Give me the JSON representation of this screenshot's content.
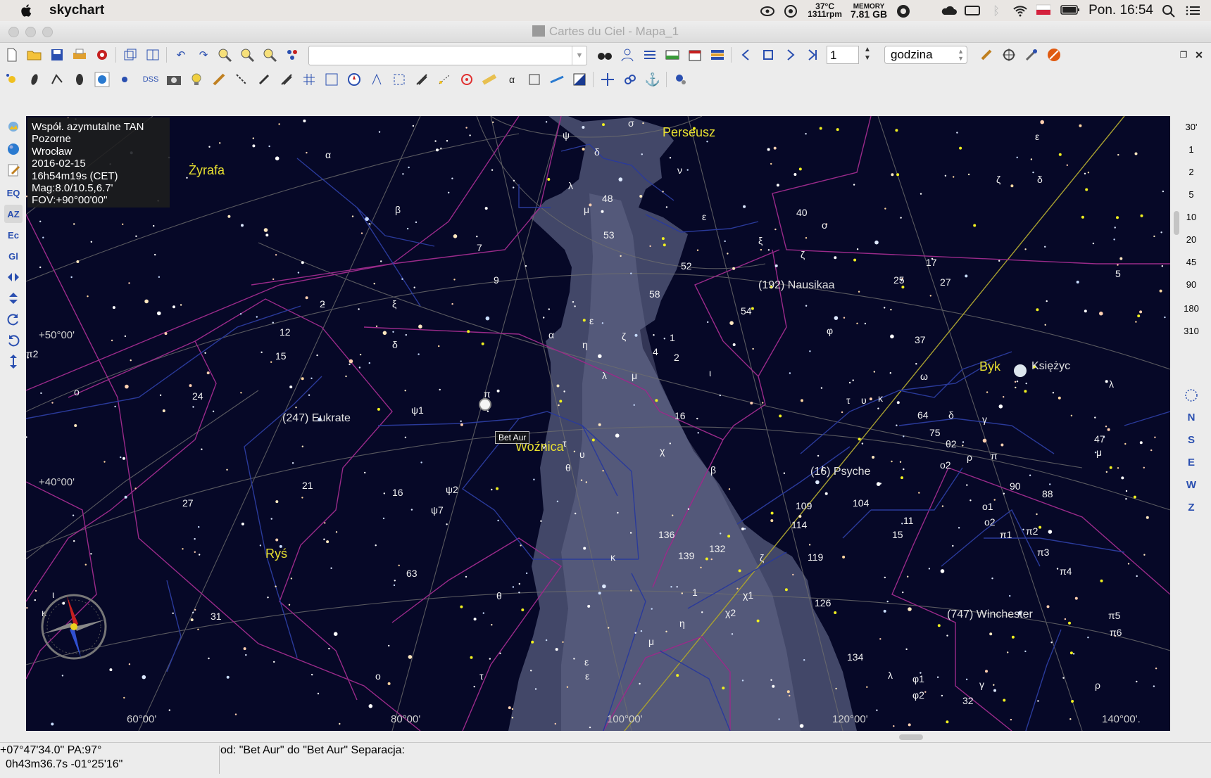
{
  "menubar": {
    "app_name": "skychart",
    "temp": "37°C",
    "rpm": "1311rpm",
    "memory_label": "MEMORY",
    "memory_value": "7.81 GB",
    "clock": "Pon. 16:54"
  },
  "window": {
    "title": "Cartes du Ciel - Mapa_1"
  },
  "toolbar": {
    "search_value": "",
    "step_value": "1",
    "unit_value": "godzina"
  },
  "left_toolbar": {
    "dss": "DSS",
    "eq": "EQ",
    "az": "AZ",
    "ec": "Ec",
    "gl": "Gl"
  },
  "right_toolbar": {
    "fov_buttons": [
      "30'",
      "1",
      "2",
      "5",
      "10",
      "20",
      "45",
      "90",
      "180",
      "310"
    ],
    "directions": [
      "N",
      "S",
      "E",
      "W",
      "Z"
    ]
  },
  "info": {
    "projection": "Współ. azymutalne TAN",
    "coords_type": "Pozorne",
    "location": "Wrocław",
    "date": "2016-02-15",
    "time": "16h54m19s (CET)",
    "mag": "Mag:8.0/10.5,6.7'",
    "fov": "FOV:+90°00'00\""
  },
  "chart": {
    "selected_star_label": "Bet Aur",
    "constellations": [
      {
        "name": "Perseusz"
      },
      {
        "name": "Żyrafa"
      },
      {
        "name": "Woźnica"
      },
      {
        "name": "Byk"
      },
      {
        "name": "Ryś"
      }
    ],
    "bodies": [
      {
        "name": "(192) Nausikaa"
      },
      {
        "name": "(247) Eukrate"
      },
      {
        "name": "(16) Psyche"
      },
      {
        "name": "(747) Winchester"
      },
      {
        "name": "Księżyc"
      }
    ],
    "grid_labels": {
      "dec_50": "+50°00'",
      "dec_40": "+40°00'",
      "ra_60": "60°00'",
      "ra_80": "80°00'",
      "ra_100": "100°00'",
      "ra_120": "120°00'",
      "ra_140": "140°00'."
    },
    "star_labels": [
      {
        "t": "σ"
      },
      {
        "t": "ψ"
      },
      {
        "t": "δ"
      },
      {
        "t": "ν"
      },
      {
        "t": "λ"
      },
      {
        "t": "48"
      },
      {
        "t": "μ"
      },
      {
        "t": "53"
      },
      {
        "t": "ε"
      },
      {
        "t": "40"
      },
      {
        "t": "ο"
      },
      {
        "t": "ξ"
      },
      {
        "t": "ζ"
      },
      {
        "t": "52"
      },
      {
        "t": "58"
      },
      {
        "t": "54"
      },
      {
        "t": "α"
      },
      {
        "t": "β"
      },
      {
        "t": "7"
      },
      {
        "t": "9"
      },
      {
        "t": "2"
      },
      {
        "t": "12"
      },
      {
        "t": "15"
      },
      {
        "t": "π2"
      },
      {
        "t": "ξ"
      },
      {
        "t": "δ"
      },
      {
        "t": "α"
      },
      {
        "t": "ε"
      },
      {
        "t": "η"
      },
      {
        "t": "ζ"
      },
      {
        "t": "1"
      },
      {
        "t": "4"
      },
      {
        "t": "2"
      },
      {
        "t": "ι"
      },
      {
        "t": "λ"
      },
      {
        "t": "μ"
      },
      {
        "t": "φ"
      },
      {
        "t": "ο"
      },
      {
        "t": "24"
      },
      {
        "t": "ψ1"
      },
      {
        "t": "π"
      },
      {
        "t": "16"
      },
      {
        "t": "ν"
      },
      {
        "t": "τ"
      },
      {
        "t": "υ"
      },
      {
        "t": "χ"
      },
      {
        "t": "θ"
      },
      {
        "t": "β"
      },
      {
        "t": "21"
      },
      {
        "t": "16"
      },
      {
        "t": "ψ2"
      },
      {
        "t": "ψ7"
      },
      {
        "t": "27"
      },
      {
        "t": "63"
      },
      {
        "t": "κ"
      },
      {
        "t": "136"
      },
      {
        "t": "139"
      },
      {
        "t": "132"
      },
      {
        "t": "θ"
      },
      {
        "t": "1"
      },
      {
        "t": "η"
      },
      {
        "t": "μ"
      },
      {
        "t": "χ1"
      },
      {
        "t": "χ2"
      },
      {
        "t": "ε"
      },
      {
        "t": "ζ"
      },
      {
        "t": "119"
      },
      {
        "t": "126"
      },
      {
        "t": "134"
      },
      {
        "t": "109"
      },
      {
        "t": "104"
      },
      {
        "t": "114"
      },
      {
        "t": "ι"
      },
      {
        "t": "τ"
      },
      {
        "t": "υ"
      },
      {
        "t": "κ"
      },
      {
        "t": "ω"
      },
      {
        "t": "37"
      },
      {
        "t": "17"
      },
      {
        "t": "25"
      },
      {
        "t": "27"
      },
      {
        "t": "5"
      },
      {
        "t": "ε"
      },
      {
        "t": "ζ"
      },
      {
        "t": "δ"
      },
      {
        "t": "64"
      },
      {
        "t": "δ"
      },
      {
        "t": "γ"
      },
      {
        "t": "75"
      },
      {
        "t": "θ2"
      },
      {
        "t": "ο2"
      },
      {
        "t": "ρ"
      },
      {
        "t": "π"
      },
      {
        "t": "47"
      },
      {
        "t": "μ"
      },
      {
        "t": "λ"
      },
      {
        "t": "90"
      },
      {
        "t": "88"
      },
      {
        "t": "ο1"
      },
      {
        "t": "11"
      },
      {
        "t": "ο2"
      },
      {
        "t": "15"
      },
      {
        "t": "π1"
      },
      {
        "t": "π2"
      },
      {
        "t": "π3"
      },
      {
        "t": "π4"
      },
      {
        "t": "π5"
      },
      {
        "t": "π6"
      },
      {
        "t": "λ"
      },
      {
        "t": "φ1"
      },
      {
        "t": "φ2"
      },
      {
        "t": "γ"
      },
      {
        "t": "32"
      },
      {
        "t": "ρ"
      },
      {
        "t": "31"
      },
      {
        "t": "ι"
      },
      {
        "t": "κ"
      },
      {
        "t": "ο"
      },
      {
        "t": "τ"
      },
      {
        "t": "ε"
      }
    ]
  },
  "status": {
    "line1": "+07°47'34.0\" PA:97°",
    "line2": "0h43m36.7s -01°25'16\"",
    "message": "od:  \"Bet Aur\" do \"Bet Aur\" Separacja:"
  }
}
